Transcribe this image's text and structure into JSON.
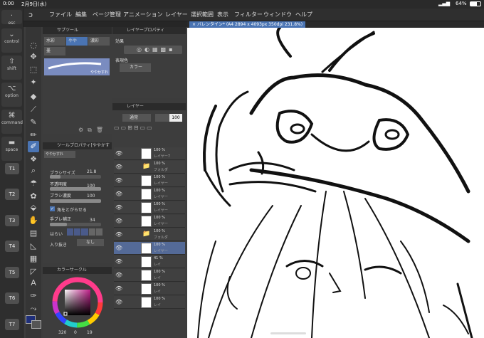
{
  "status": {
    "time": "0:00",
    "date": "2月9日(水)",
    "battery": "64%"
  },
  "edge": {
    "buttons": [
      {
        "glyph": "⌄",
        "label": "control"
      },
      {
        "glyph": "⇧",
        "label": "shift"
      },
      {
        "glyph": "⌥",
        "label": "option"
      },
      {
        "glyph": "⌘",
        "label": "command"
      },
      {
        "glyph": "▬",
        "label": "space"
      }
    ],
    "top_label": "esc",
    "quick": [
      "T1",
      "T2",
      "T3",
      "T4",
      "T5",
      "T6",
      "T7"
    ]
  },
  "menu": [
    "ファイル",
    "編集",
    "ページ管理",
    "アニメーション",
    "レイヤー",
    "選択範囲",
    "表示",
    "フィルター",
    "ウィンドウ",
    "ヘルプ"
  ],
  "subtool": {
    "title": "サブツール",
    "items": [
      "水彩",
      "やや",
      "濃彩",
      "墨"
    ],
    "brush_name": "ややかすれ"
  },
  "layer_property": {
    "title": "レイヤープロパティ",
    "effect_label": "効果",
    "expression_label": "表現色",
    "expression_value": "カラー"
  },
  "layer_panel": {
    "title": "レイヤー",
    "blend": "通常",
    "opacity": "100",
    "rows": [
      {
        "opacity": "100 %",
        "name": "レイヤー7",
        "type": "layer"
      },
      {
        "opacity": "100 %",
        "name": "フォルダ",
        "type": "folder"
      },
      {
        "opacity": "100 %",
        "name": "レイヤー",
        "type": "layer"
      },
      {
        "opacity": "100 %",
        "name": "レイヤー",
        "type": "layer"
      },
      {
        "opacity": "100 %",
        "name": "レイヤー",
        "type": "layer"
      },
      {
        "opacity": "100 %",
        "name": "レイヤー",
        "type": "layer"
      },
      {
        "opacity": "100 %",
        "name": "フォルダ",
        "type": "folder"
      },
      {
        "opacity": "100 %",
        "name": "レイヤー",
        "type": "layer"
      },
      {
        "opacity": "41 %",
        "name": "レイ",
        "type": "layer"
      },
      {
        "opacity": "100 %",
        "name": "レイ",
        "type": "layer"
      },
      {
        "opacity": "100 %",
        "name": "レイ",
        "type": "layer"
      },
      {
        "opacity": "100 %",
        "name": "レイ",
        "type": "layer"
      }
    ]
  },
  "tool_property": {
    "title": "ツールプロパティ[ややかす",
    "brush_name": "ややかすれ",
    "brush_size_label": "ブラシサイズ",
    "brush_size": "21.8",
    "opacity_label": "不透明度",
    "opacity": "100",
    "density_label": "ブラシ濃度",
    "density": "100",
    "sharpen_label": "角をとがらせる",
    "stabilize_label": "手ブレ補正",
    "stabilize": "34",
    "stabilize_fraction": 0.34,
    "brush_size_fraction": 0.21,
    "opacity_fraction": 1.0,
    "density_fraction": 1.0,
    "harai_label": "はらい",
    "entry_label": "入り抜き",
    "entry_value": "なし"
  },
  "color_circle": {
    "title": "カラーサークル",
    "hsv": "320",
    "v1": "0",
    "v2": "19"
  },
  "canvas": {
    "tab_title": "バレンタイン* (A4 2894 x 4093px 350dpi 231.8%)"
  }
}
